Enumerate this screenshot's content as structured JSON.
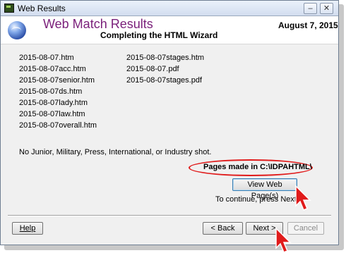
{
  "window": {
    "title": "Web Results"
  },
  "titlebar_buttons": {
    "minimize": "–",
    "close": "✕"
  },
  "header": {
    "title": "Web Match Results",
    "subtitle": "Completing the HTML Wizard",
    "date": "August  7, 2015"
  },
  "files": {
    "column1": [
      "2015-08-07.htm",
      "2015-08-07acc.htm",
      "2015-08-07senior.htm",
      "2015-08-07ds.htm",
      "2015-08-07lady.htm",
      "2015-08-07law.htm",
      "2015-08-07overall.htm"
    ],
    "column2": [
      "2015-08-07stages.htm",
      "2015-08-07.pdf",
      "2015-08-07stages.pdf"
    ]
  },
  "notice": "No Junior, Military, Press, International, or Industry shot.",
  "pages_made": "Pages made in C:\\IDPAHTML\\",
  "view_button": "View Web Page(s)",
  "continue_text": "To continue, press Next.",
  "footer": {
    "help": "Help",
    "back": "< Back",
    "next": "Next >",
    "cancel": "Cancel"
  },
  "icons": {
    "app": "app-icon",
    "globe": "globe-icon",
    "cursor": "arrow-cursor-icon"
  },
  "colors": {
    "title_accent": "#7a1f7a",
    "highlight": "#e01b1b"
  }
}
